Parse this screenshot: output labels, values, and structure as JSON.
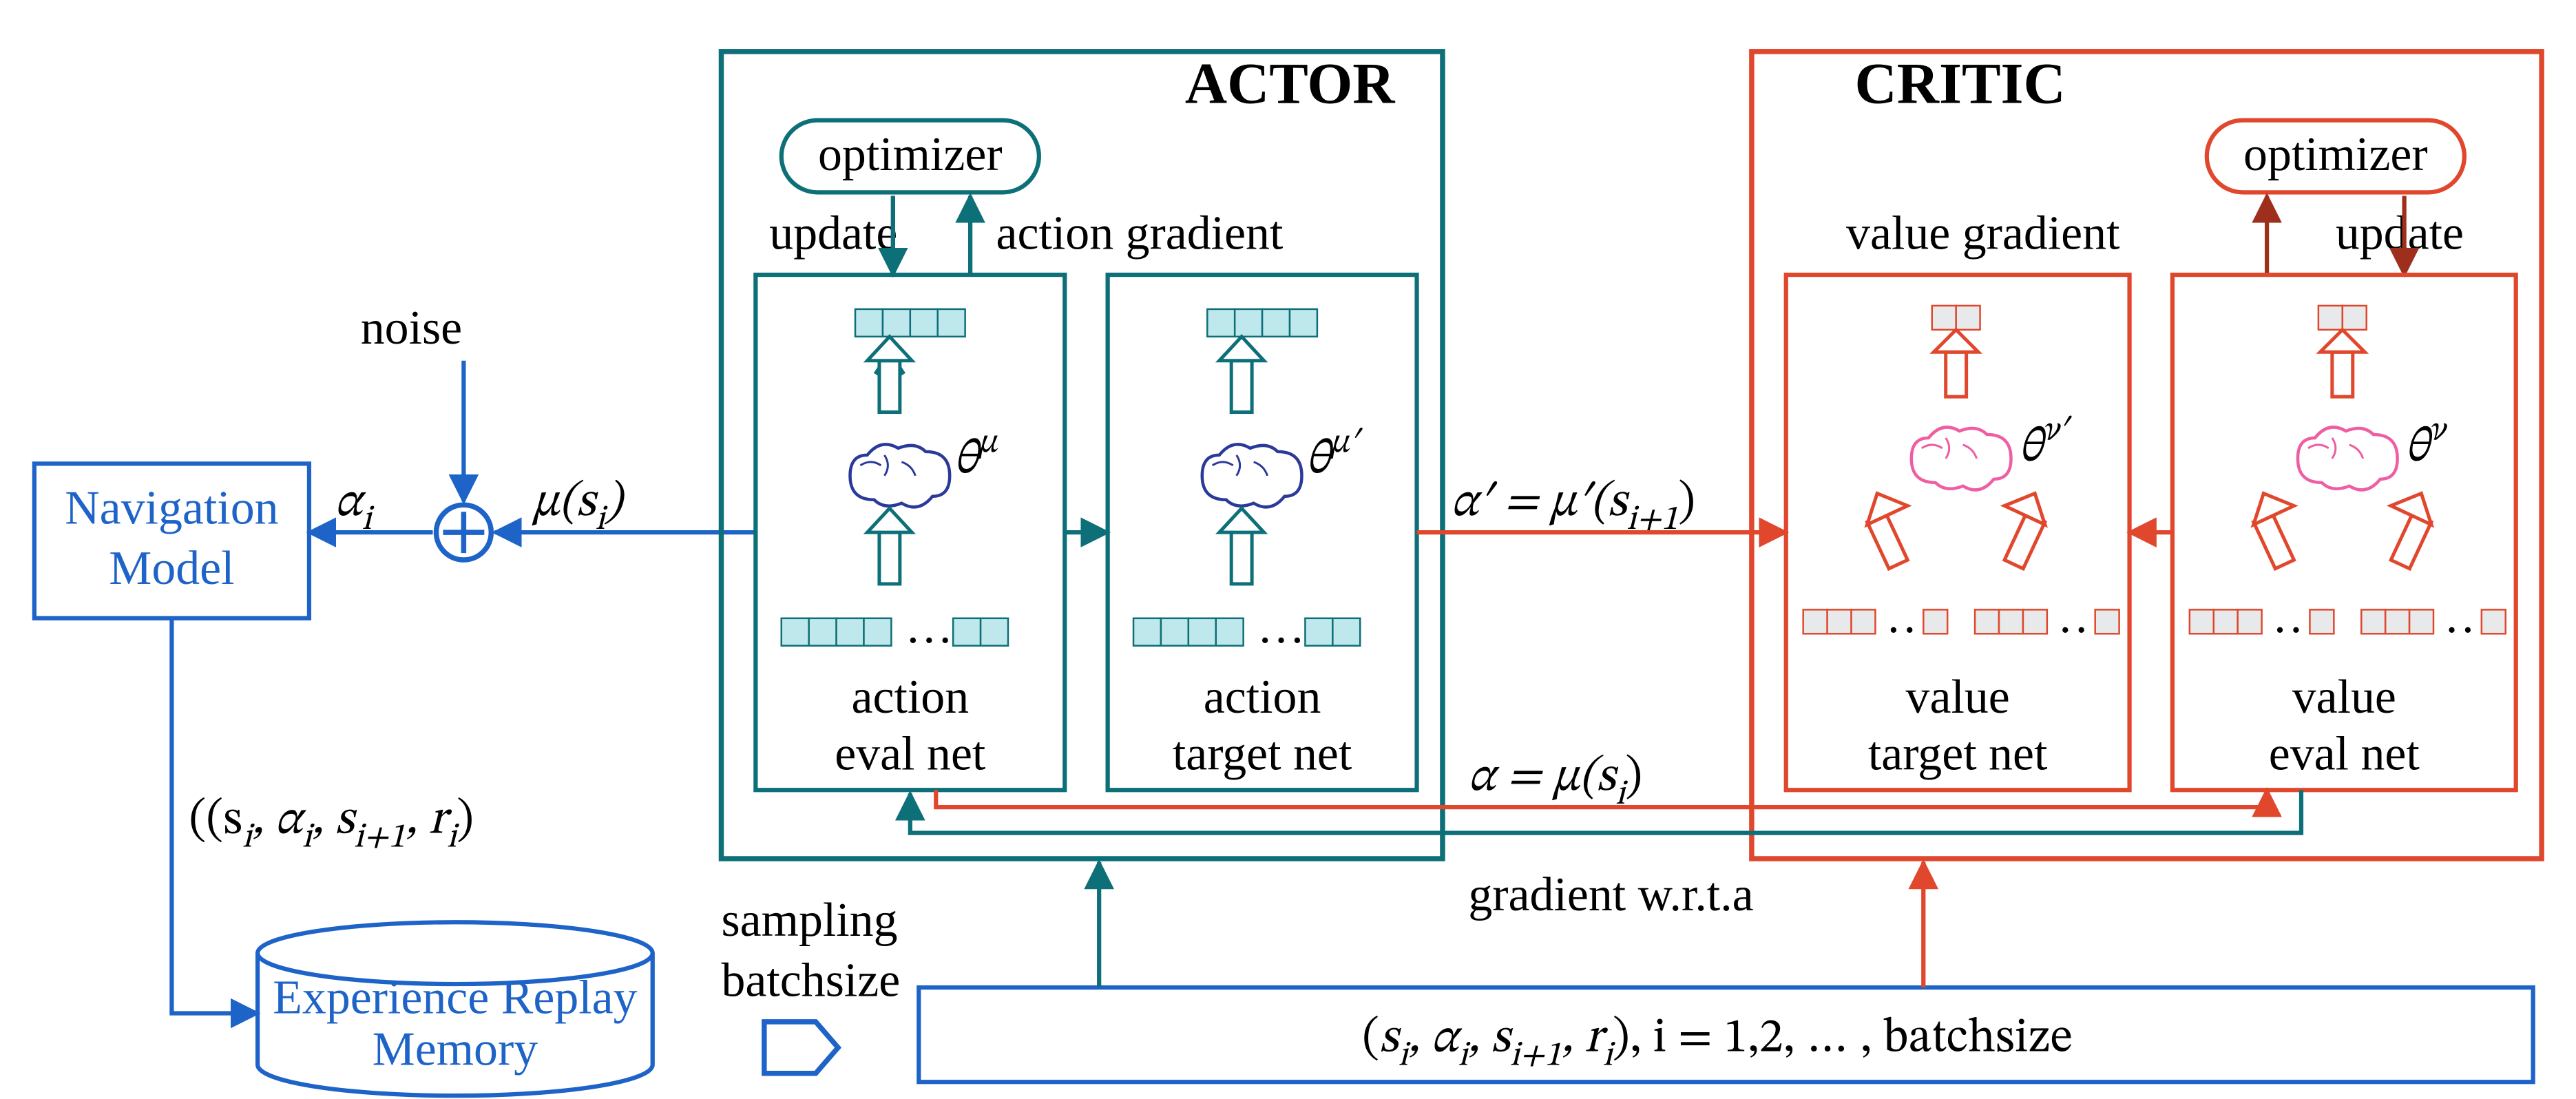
{
  "labels": {
    "noise": "noise",
    "alpha_i": "α",
    "alpha_i_sub": "i",
    "mu_si": "µ(s",
    "mu_si_sub": "i",
    "mu_si_close": ")",
    "nav_model_1": "Navigation",
    "nav_model_2": "Model",
    "tuple": "(s",
    "tuple_si_sub": "i",
    "tuple_comma1": ", α",
    "tuple_ai_sub": "i",
    "tuple_comma2": ", s",
    "tuple_si1_sub": "i+1",
    "tuple_comma3": ", r",
    "tuple_ri_sub": "i",
    "tuple_close": ")",
    "replay_1": "Experience Replay",
    "replay_2": "Memory",
    "sampling_1": "sampling",
    "sampling_2": "batchsize",
    "batch_text_1": "(s",
    "batch_text_1_sub": "i",
    "batch_text_2": ", α",
    "batch_text_2_sub": "i",
    "batch_text_3": ", s",
    "batch_text_3_sub": "i+1",
    "batch_text_4": ", r",
    "batch_text_4_sub": "i",
    "batch_text_close": "), i = 1,2, … , batchsize",
    "actor_title": "ACTOR",
    "critic_title": "CRITIC",
    "optimizer": "optimizer",
    "update": "update",
    "action_gradient": "action  gradient",
    "value_gradient": "value  gradient",
    "action_eval_1": "action",
    "action_eval_2": "eval net",
    "action_target_1": "action",
    "action_target_2": "target net",
    "value_target_1": "value",
    "value_target_2": "target net",
    "value_eval_1": "value",
    "value_eval_2": "eval net",
    "theta_mu": "θ",
    "theta_mu_sup": "µ",
    "theta_mup": "θ",
    "theta_mup_sup": "µ′",
    "theta_nup": "θ",
    "theta_nup_sup": "ν′",
    "theta_nu": "θ",
    "theta_nu_sup": "ν",
    "alpha_prime": "α′ = µ′(s",
    "alpha_prime_sub": "i+1",
    "alpha_prime_close": ")",
    "alpha_eq": "α = µ(s",
    "alpha_eq_sub": "i",
    "alpha_eq_close": ")",
    "grad_wrt_a": "gradient w.r.t.a"
  },
  "colors": {
    "blue": "#1e63c8",
    "teal": "#0d6f78",
    "teal_dark": "#115e67",
    "red": "#e0472c",
    "red_dark": "#b33a25",
    "cyan_fill": "#bfe8ec",
    "gray_fill": "#e7e9ea",
    "pink": "#ef5da2"
  }
}
